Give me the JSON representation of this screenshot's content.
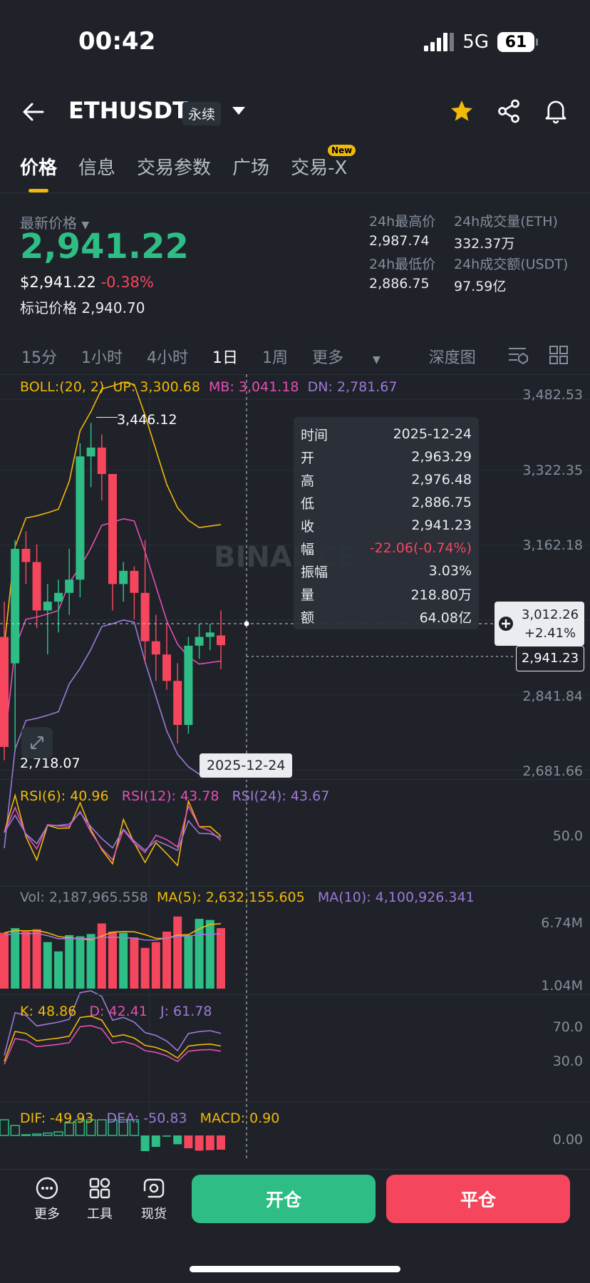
{
  "status": {
    "time": "00:42",
    "network": "5G",
    "battery": "61"
  },
  "header": {
    "symbol": "ETHUSDT",
    "badge": "永续",
    "icons": [
      "back-arrow-icon",
      "chevron-down-icon",
      "star-icon",
      "share-icon",
      "bell-icon"
    ],
    "star_color": "#f0b90b"
  },
  "tabs": [
    {
      "label": "价格",
      "active": true
    },
    {
      "label": "信息"
    },
    {
      "label": "交易参数"
    },
    {
      "label": "广场"
    },
    {
      "label": "交易-X",
      "badge": "New"
    }
  ],
  "ticker": {
    "latest_label": "最新价格",
    "last_price": "2,941.22",
    "usd_price": "$2,941.22",
    "change": "-0.38%",
    "mark_label": "标记价格",
    "mark_price": "2,940.70",
    "high_label": "24h最高价",
    "high": "2,987.74",
    "low_label": "24h最低价",
    "low": "2,886.75",
    "vol_eth_label": "24h成交量(ETH)",
    "vol_eth": "332.37万",
    "vol_usdt_label": "24h成交额(USDT)",
    "vol_usdt": "97.59亿"
  },
  "intervals": {
    "items": [
      "15分",
      "1小时",
      "4小时",
      "1日",
      "1周"
    ],
    "active": "1日",
    "more": "更多",
    "depth": "深度图"
  },
  "boll": {
    "label": "BOLL:(20, 2)",
    "up": "UP: 3,300.68",
    "mb": "MB: 3,041.18",
    "dn": "DN: 2,781.67"
  },
  "main_axis": [
    "3,482.53",
    "3,322.35",
    "3,162.18",
    "2,841.84",
    "2,681.66"
  ],
  "annotations": {
    "high": "3,446.12",
    "low": "2,718.07",
    "crosshair_date": "2025-12-24",
    "watermark": "BINANCE"
  },
  "crosshair_tag": {
    "price": "3,012.26",
    "pct": "+2.41%"
  },
  "last_price_tag": "2,941.23",
  "tooltip": [
    {
      "k": "时间",
      "v": "2025-12-24"
    },
    {
      "k": "开",
      "v": "2,963.29"
    },
    {
      "k": "高",
      "v": "2,976.48"
    },
    {
      "k": "低",
      "v": "2,886.75"
    },
    {
      "k": "收",
      "v": "2,941.23"
    },
    {
      "k": "幅",
      "v": "-22.06(-0.74%)",
      "red": true
    },
    {
      "k": "振幅",
      "v": "3.03%"
    },
    {
      "k": "量",
      "v": "218.80万"
    },
    {
      "k": "额",
      "v": "64.08亿"
    }
  ],
  "rsi": {
    "r6": "RSI(6): 40.96",
    "r12": "RSI(12): 43.78",
    "r24": "RSI(24): 43.67",
    "axis": "50.0"
  },
  "vol": {
    "vol": "Vol: 2,187,965.558",
    "ma5": "MA(5): 2,632,155.605",
    "ma10": "MA(10): 4,100,926.341",
    "axis_top": "6.74M",
    "axis_bottom": "1.04M"
  },
  "kdj": {
    "k": "K: 48.86",
    "d": "D: 42.41",
    "j": "J: 61.78",
    "axis_top": "70.0",
    "axis_bottom": "30.0"
  },
  "macd": {
    "dif": "DIF: -49.93",
    "dea": "DEA: -50.83",
    "macd": "MACD: 0.90",
    "axis": "0.00"
  },
  "bottom": {
    "more": "更多",
    "tools": "工具",
    "spot": "现货",
    "open": "开仓",
    "close": "平仓"
  },
  "colors": {
    "up": "#2ebd85",
    "down": "#f6465d",
    "accent": "#f0b90b",
    "bg": "#1f2229"
  },
  "chart_data": {
    "type": "candlestick",
    "timeframe": "1日",
    "last_date": "2025-12-24",
    "candles": [
      {
        "o": 2960,
        "h": 3040,
        "l": 2680,
        "c": 2710
      },
      {
        "o": 2900,
        "h": 3180,
        "l": 2700,
        "c": 3160
      },
      {
        "o": 3160,
        "h": 3200,
        "l": 3080,
        "c": 3130
      },
      {
        "o": 3130,
        "h": 3170,
        "l": 2980,
        "c": 3020
      },
      {
        "o": 3020,
        "h": 3080,
        "l": 2920,
        "c": 3040
      },
      {
        "o": 3040,
        "h": 3090,
        "l": 2970,
        "c": 3060
      },
      {
        "o": 3060,
        "h": 3160,
        "l": 3010,
        "c": 3090
      },
      {
        "o": 3090,
        "h": 3400,
        "l": 3050,
        "c": 3370
      },
      {
        "o": 3370,
        "h": 3446.12,
        "l": 3300,
        "c": 3390
      },
      {
        "o": 3390,
        "h": 3420,
        "l": 3270,
        "c": 3330
      },
      {
        "o": 3330,
        "h": 3260,
        "l": 3020,
        "c": 3080
      },
      {
        "o": 3080,
        "h": 3130,
        "l": 3040,
        "c": 3110
      },
      {
        "o": 3110,
        "h": 3120,
        "l": 3000,
        "c": 3060
      },
      {
        "o": 3060,
        "h": 3180,
        "l": 2900,
        "c": 2950
      },
      {
        "o": 2950,
        "h": 3010,
        "l": 2860,
        "c": 2920
      },
      {
        "o": 2920,
        "h": 2990,
        "l": 2840,
        "c": 2860
      },
      {
        "o": 2860,
        "h": 2900,
        "l": 2718.07,
        "c": 2760
      },
      {
        "o": 2760,
        "h": 2960,
        "l": 2740,
        "c": 2940
      },
      {
        "o": 2940,
        "h": 2990,
        "l": 2910,
        "c": 2960
      },
      {
        "o": 2960,
        "h": 2990,
        "l": 2930,
        "c": 2970
      },
      {
        "o": 2963.29,
        "h": 3020,
        "l": 2886.75,
        "c": 2941.23
      }
    ],
    "volume_millions": [
      4.8,
      5.2,
      4.9,
      5.1,
      4.0,
      3.2,
      4.6,
      4.5,
      4.7,
      5.6,
      4.9,
      4.8,
      4.4,
      3.5,
      4.0,
      4.9,
      6.2,
      4.6,
      6.0,
      5.9,
      5.2
    ],
    "y_range": [
      2650,
      3500
    ]
  }
}
